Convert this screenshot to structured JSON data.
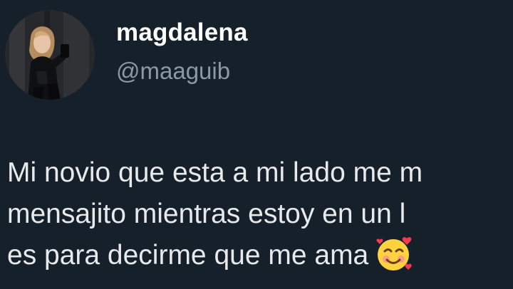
{
  "tweet": {
    "author": {
      "display_name": "magdalena",
      "handle": "@maaguib",
      "avatar_alt": "profile photo"
    },
    "text_lines": [
      "Mi novio que esta a mi lado me m",
      "mensajito mientras estoy en un l",
      "es para decirme que me ama"
    ],
    "emoji": "smiling-face-with-hearts-icon"
  },
  "colors": {
    "background": "#15202b",
    "text": "#e7e9ea",
    "secondary_text": "#8b98a5"
  }
}
